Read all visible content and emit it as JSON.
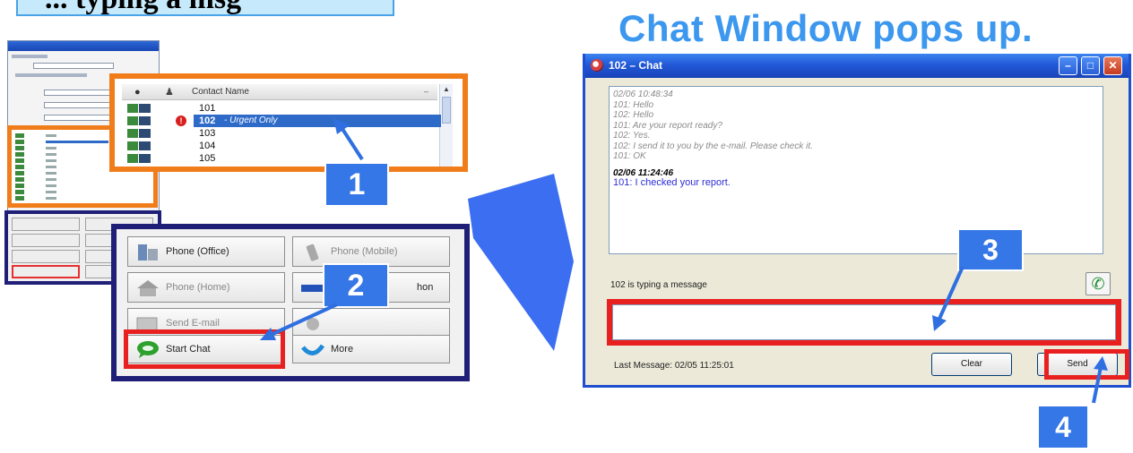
{
  "banner": {
    "text": "... typing a msg"
  },
  "headline": "Chat Window pops up.",
  "contact_list": {
    "column_header": "Contact Name",
    "rows": [
      {
        "id": "101",
        "selected": false,
        "urgent": false,
        "note": ""
      },
      {
        "id": "102",
        "selected": true,
        "urgent": true,
        "note": "- Urgent Only"
      },
      {
        "id": "103",
        "selected": false,
        "urgent": false,
        "note": ""
      },
      {
        "id": "104",
        "selected": false,
        "urgent": false,
        "note": ""
      },
      {
        "id": "105",
        "selected": false,
        "urgent": false,
        "note": ""
      }
    ]
  },
  "actions": {
    "phone_office": "Phone (Office)",
    "phone_mobile": "Phone (Mobile)",
    "phone_home": "Phone (Home)",
    "phone_other_suffix": "hon",
    "send_email": "Send E-mail",
    "start_chat": "Start Chat",
    "more": "More"
  },
  "badges": {
    "one": "1",
    "two": "2",
    "three": "3",
    "four": "4"
  },
  "chat_window": {
    "title": "102 – Chat",
    "log": {
      "old_lines": [
        "02/06 10:48:34",
        "101: Hello",
        "102: Hello",
        "101: Are your report ready?",
        "102: Yes.",
        "102: I send it to you by the e-mail. Please check it.",
        "101: OK"
      ],
      "new_stamp": "02/06 11:24:46",
      "new_line": "101: I checked your report."
    },
    "typing_status": "102 is typing a message",
    "last_message": "Last Message: 02/05 11:25:01",
    "clear_label": "Clear",
    "send_label": "Send",
    "colors": {
      "titlebar": "#2259d8",
      "highlight": "#e82020",
      "badge": "#3577e6",
      "headline": "#3c97ef"
    }
  }
}
